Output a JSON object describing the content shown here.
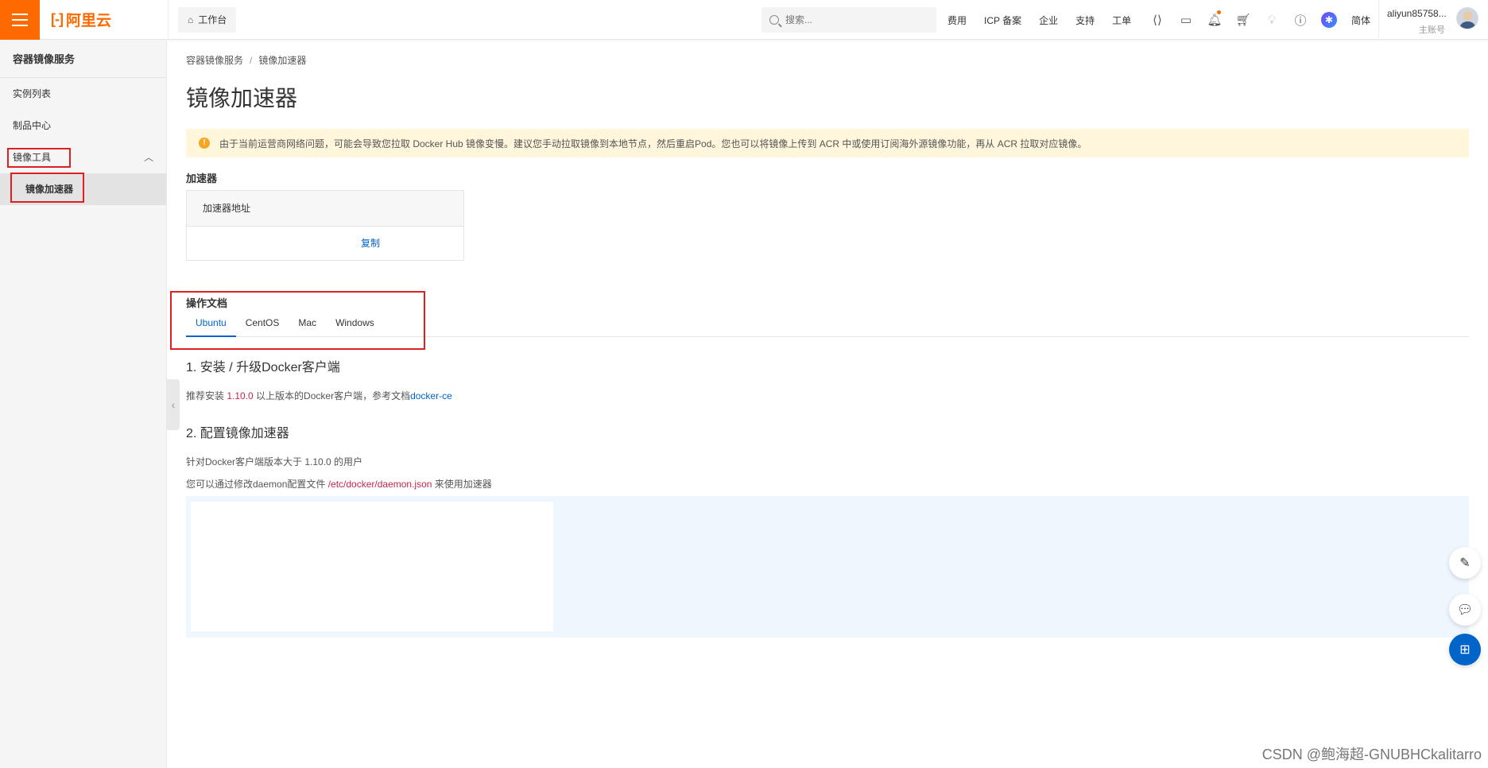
{
  "topbar": {
    "logo_mark": "[-]",
    "logo_text": "阿里云",
    "workbench_label": "工作台",
    "search_placeholder": "搜索...",
    "links": [
      "费用",
      "ICP 备案",
      "企业",
      "支持",
      "工单"
    ],
    "language": "简体",
    "username": "aliyun85758...",
    "account_role": "主账号",
    "icons": [
      "code-icon",
      "terminal-icon",
      "bell-icon",
      "cart-icon",
      "lightbulb-icon",
      "help-icon",
      "assistant-icon"
    ],
    "accent_color": "#ff6a00"
  },
  "sidebar": {
    "title": "容器镜像服务",
    "items": [
      {
        "label": "实例列表"
      },
      {
        "label": "制品中心"
      },
      {
        "label": "镜像工具"
      },
      {
        "label": "镜像加速器"
      }
    ]
  },
  "main": {
    "breadcrumb": [
      "容器镜像服务",
      "镜像加速器"
    ],
    "title": "镜像加速器",
    "notice": "由于当前运营商网络问题，可能会导致您拉取 Docker Hub 镜像变慢。建议您手动拉取镜像到本地节点，然后重启Pod。您也可以将镜像上传到 ACR 中或使用订阅海外源镜像功能，再从 ACR 拉取对应镜像。",
    "accelerator_section": "加速器",
    "accelerator_table_header": "加速器地址",
    "copy_label": "复制",
    "docs_section": "操作文档",
    "tabs": [
      "Ubuntu",
      "CentOS",
      "Mac",
      "Windows"
    ],
    "active_tab": "Ubuntu",
    "step1_title": "1. 安装 / 升级Docker客户端",
    "step1_text_prefix": "推荐安装 ",
    "step1_version": "1.10.0",
    "step1_text_middle": " 以上版本的Docker客户端，参考文档",
    "step1_link": "docker-ce",
    "step2_title": "2. 配置镜像加速器",
    "step2_line1": "针对Docker客户端版本大于 1.10.0 的用户",
    "step2_line2_prefix": "您可以通过修改daemon配置文件 ",
    "step2_path": "/etc/docker/daemon.json",
    "step2_line2_suffix": " 来使用加速器"
  },
  "watermark": "CSDN @鲍海超-GNUBHCkalitarro"
}
